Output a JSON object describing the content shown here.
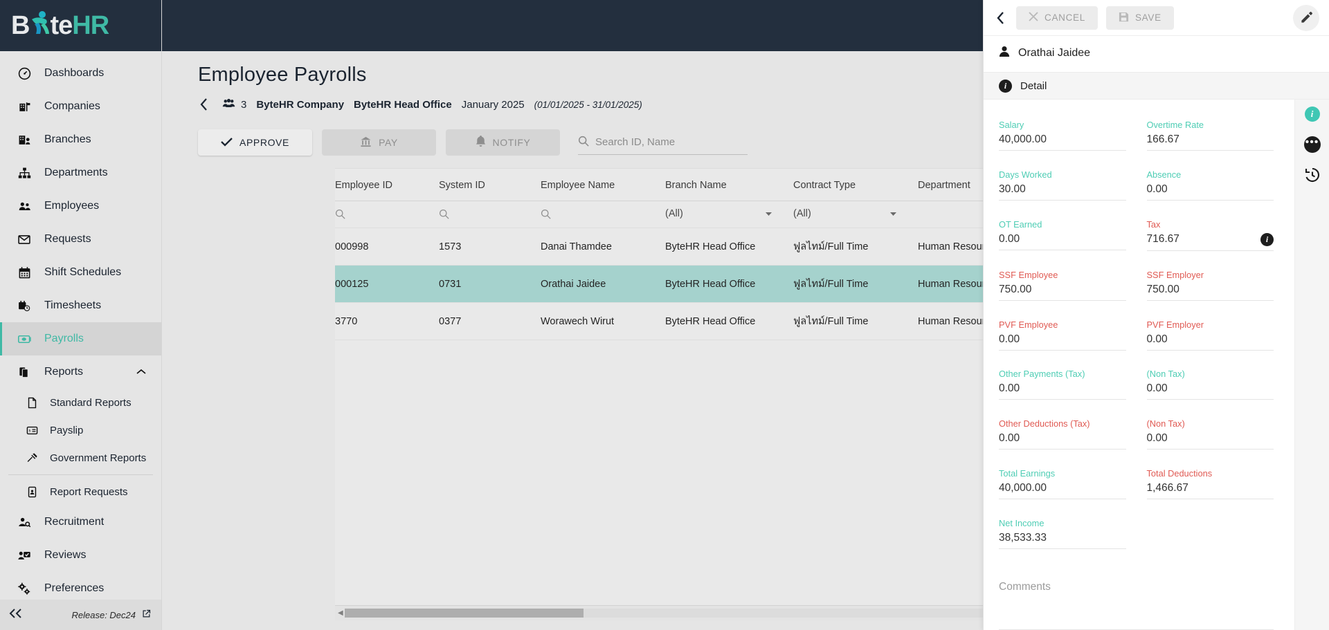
{
  "brand": {
    "part1": "B",
    "part2": "te",
    "part3": "HR",
    "icon": "byte-runner-logo"
  },
  "sidebar": {
    "items": [
      {
        "label": "Dashboards",
        "icon": "speedometer-icon"
      },
      {
        "label": "Companies",
        "icon": "company-building-icon"
      },
      {
        "label": "Branches",
        "icon": "branch-building-icon"
      },
      {
        "label": "Departments",
        "icon": "org-chart-icon"
      },
      {
        "label": "Employees",
        "icon": "people-icon"
      },
      {
        "label": "Requests",
        "icon": "envelope-icon"
      },
      {
        "label": "Shift Schedules",
        "icon": "calendar-icon"
      },
      {
        "label": "Timesheets",
        "icon": "timesheet-clock-icon"
      },
      {
        "label": "Payrolls",
        "icon": "banknote-icon",
        "active": true
      },
      {
        "label": "Reports",
        "icon": "documents-icon",
        "expanded": true
      }
    ],
    "report_children": [
      {
        "label": "Standard Reports",
        "icon": "file-icon"
      },
      {
        "label": "Payslip",
        "icon": "payslip-card-icon"
      },
      {
        "label": "Government Reports",
        "icon": "gavel-icon"
      },
      {
        "label": "Report Requests",
        "icon": "file-person-icon"
      }
    ],
    "items_after": [
      {
        "label": "Recruitment",
        "icon": "person-search-icon"
      },
      {
        "label": "Reviews",
        "icon": "person-review-icon"
      },
      {
        "label": "Preferences",
        "icon": "gears-icon"
      }
    ],
    "footer": {
      "collapse": "«",
      "release": "Release: Dec24",
      "external_icon": "external-link-icon"
    }
  },
  "header": {
    "title": "Employee Payrolls",
    "back_icon": "chevron-left-icon",
    "people_icon": "people-group-icon",
    "count": "3",
    "company": "ByteHR Company",
    "branch": "ByteHR Head Office",
    "period": "January 2025",
    "date_range": "(01/01/2025 - 31/01/2025)"
  },
  "toolbar": {
    "approve": "APPROVE",
    "pay": "PAY",
    "notify": "NOTIFY",
    "approve_icon": "check-icon",
    "pay_icon": "bank-icon",
    "notify_icon": "bell-icon",
    "search_icon": "search-icon",
    "search_placeholder": "Search ID, Name",
    "search_value": ""
  },
  "table": {
    "columns": [
      "Employee ID",
      "System ID",
      "Employee Name",
      "Branch Name",
      "Contract Type",
      "Department",
      ""
    ],
    "filters": [
      {
        "type": "search",
        "value": ""
      },
      {
        "type": "search",
        "value": ""
      },
      {
        "type": "search",
        "value": ""
      },
      {
        "type": "select",
        "value": "(All)"
      },
      {
        "type": "select",
        "value": "(All)"
      },
      {
        "type": "text",
        "value": ""
      },
      {
        "type": "text",
        "value": ""
      }
    ],
    "rows": [
      {
        "employee_id": "000998",
        "system_id": "1573",
        "employee_name": "Danai Thamdee",
        "branch_name": "ByteHR Head Office",
        "contract_type": "ฟูลไทม์/Full Time",
        "department": "Human Resources",
        "selected": false
      },
      {
        "employee_id": "000125",
        "system_id": "0731",
        "employee_name": "Orathai Jaidee",
        "branch_name": "ByteHR Head Office",
        "contract_type": "ฟูลไทม์/Full Time",
        "department": "Human Resources",
        "selected": true
      },
      {
        "employee_id": "3770",
        "system_id": "0377",
        "employee_name": "Worawech Wirut",
        "branch_name": "ByteHR Head Office",
        "contract_type": "ฟูลไทม์/Full Time",
        "department": "Human Resources",
        "selected": false
      }
    ]
  },
  "panel": {
    "back_icon": "chevron-left-icon",
    "cancel": "CANCEL",
    "save": "SAVE",
    "cancel_icon": "close-x-icon",
    "save_icon": "floppy-disk-icon",
    "edit_icon": "pencil-icon",
    "person_icon": "person-icon",
    "employee_name": "Orathai Jaidee",
    "tab_label": "Detail",
    "tab_icon": "info-circle-icon",
    "fields": [
      {
        "label": "Salary",
        "value": "40,000.00",
        "tone": "pos"
      },
      {
        "label": "Overtime Rate",
        "value": "166.67",
        "tone": "pos"
      },
      {
        "label": "Days Worked",
        "value": "30.00",
        "tone": "pos"
      },
      {
        "label": "Absence",
        "value": "0.00",
        "tone": "pos"
      },
      {
        "label": "OT Earned",
        "value": "0.00",
        "tone": "pos"
      },
      {
        "label": "Tax",
        "value": "716.67",
        "tone": "neg",
        "info": true
      },
      {
        "label": "SSF Employee",
        "value": "750.00",
        "tone": "neg"
      },
      {
        "label": "SSF Employer",
        "value": "750.00",
        "tone": "neg"
      },
      {
        "label": "PVF Employee",
        "value": "0.00",
        "tone": "neg"
      },
      {
        "label": "PVF Employer",
        "value": "0.00",
        "tone": "neg"
      },
      {
        "label": "Other Payments (Tax)",
        "value": "0.00",
        "tone": "pos"
      },
      {
        "label": "(Non Tax)",
        "value": "0.00",
        "tone": "pos"
      },
      {
        "label": "Other Deductions (Tax)",
        "value": "0.00",
        "tone": "neg"
      },
      {
        "label": "(Non Tax)",
        "value": "0.00",
        "tone": "neg"
      },
      {
        "label": "Total Earnings",
        "value": "40,000.00",
        "tone": "pos"
      },
      {
        "label": "Total Deductions",
        "value": "1,466.67",
        "tone": "neg"
      },
      {
        "label": "Net Income",
        "value": "38,533.33",
        "tone": "pos"
      }
    ],
    "comments_placeholder": "Comments",
    "rail": [
      {
        "icon": "info-badge-icon",
        "name": "detail-tab-icon"
      },
      {
        "icon": "more-dots-icon",
        "name": "more-options-icon"
      },
      {
        "icon": "history-clock-icon",
        "name": "history-icon"
      }
    ]
  },
  "colors": {
    "brand_dark": "#232f3e",
    "accent_teal": "#3fb9a5",
    "selected_row": "#a5d2cd",
    "positive": "#4ecdb4",
    "negative": "#e05a53"
  }
}
